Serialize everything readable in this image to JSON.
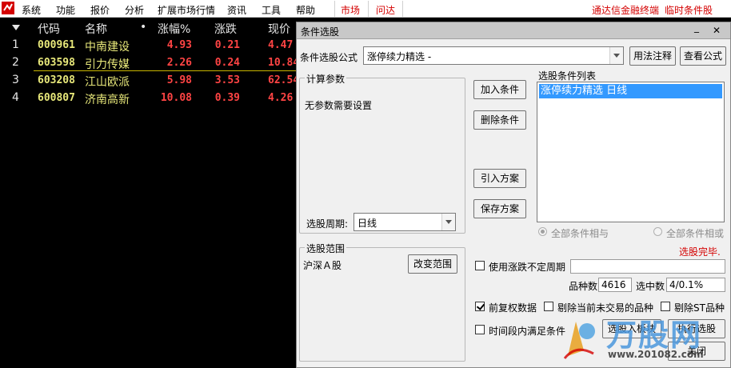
{
  "menubar": {
    "items": [
      "系统",
      "功能",
      "报价",
      "分析",
      "扩展市场行情",
      "资讯",
      "工具",
      "帮助"
    ],
    "tab_market": "市场",
    "tab_wenda": "问达",
    "right_link1": "通达信金融终端",
    "right_link2": "临时条件股",
    "brand_color": "#d40000"
  },
  "list": {
    "headers": {
      "code": "代码",
      "name": "名称",
      "dot": "•",
      "pct": "涨幅%",
      "chg": "涨跌",
      "price": "现价"
    },
    "rows": [
      {
        "idx": "1",
        "code": "000961",
        "name": "中南建设",
        "pct": "4.93",
        "chg": "0.21",
        "price": "4.47"
      },
      {
        "idx": "2",
        "code": "603598",
        "name": "引力传媒",
        "pct": "2.26",
        "chg": "0.24",
        "price": "10.84"
      },
      {
        "idx": "3",
        "code": "603208",
        "name": "江山欧派",
        "pct": "5.98",
        "chg": "3.53",
        "price": "62.54"
      },
      {
        "idx": "4",
        "code": "600807",
        "name": "济南高新",
        "pct": "10.08",
        "chg": "0.39",
        "price": "4.26"
      }
    ]
  },
  "dialog": {
    "title": "条件选股",
    "controls": {
      "minimize": "_",
      "close": "✕"
    },
    "formula_label": "条件选股公式",
    "formula_value": "涨停续力精选 -",
    "btn_usage": "用法注释",
    "btn_view": "查看公式",
    "calc_group_title": "计算参数",
    "calc_note": "无参数需要设置",
    "period_label": "选股周期:",
    "period_value": "日线",
    "btn_add": "加入条件",
    "btn_delete": "删除条件",
    "btn_import": "引入方案",
    "btn_save": "保存方案",
    "cond_list_label": "选股条件列表",
    "cond_list_item": "涨停续力精选  日线",
    "radio_and": "全部条件相与",
    "radio_or": "全部条件相或",
    "status": "选股完毕.",
    "range_group_title": "选股范围",
    "range_value": "沪深Ａ股",
    "btn_change_range": "改变范围",
    "chk_period": "使用涨跌不定周期",
    "count_label": "品种数",
    "count_value": "4616",
    "selected_label": "选中数",
    "selected_value": "4/0.1%",
    "chk_adjust": "前复权数据",
    "chk_exclude_no_trade": "剔除当前未交易的品种",
    "chk_exclude_st": "剔除ST品种",
    "chk_time_range": "时间段内满足条件",
    "btn_to_board": "选股入板块",
    "btn_run": "执行选股",
    "btn_close": "关闭"
  },
  "watermark": {
    "brand": "万股网",
    "url": "www.201082.com"
  }
}
